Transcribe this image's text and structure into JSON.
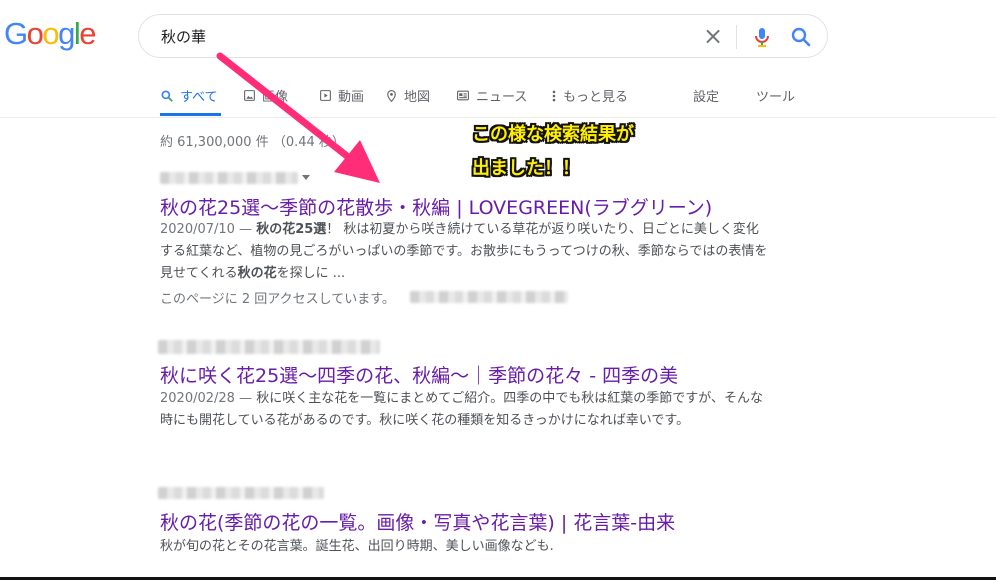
{
  "logo": {
    "letters": [
      "G",
      "o",
      "o",
      "g",
      "l",
      "e"
    ],
    "colors": [
      "#4285F4",
      "#EA4335",
      "#FBBC05",
      "#4285F4",
      "#34A853",
      "#EA4335"
    ]
  },
  "search": {
    "query": "秋の華"
  },
  "tabs": [
    {
      "label": "すべて",
      "icon": "search-icon",
      "active": true
    },
    {
      "label": "画像",
      "icon": "image-icon"
    },
    {
      "label": "動画",
      "icon": "play-icon"
    },
    {
      "label": "地図",
      "icon": "map-pin-icon"
    },
    {
      "label": "ニュース",
      "icon": "news-icon"
    },
    {
      "label": "もっと見る",
      "icon": "more-vert-icon"
    },
    {
      "label": "設定"
    },
    {
      "label": "ツール"
    }
  ],
  "stats": "約 61,300,000 件 （0.44 秒）",
  "results": [
    {
      "title": "秋の花25選〜季節の花散歩・秋編 | LOVEGREEN(ラブグリーン)",
      "date": "2020/07/10 — ",
      "snippet_b1": "秋の花25選",
      "snippet_t1": "！ 秋は初夏から咲き続けている草花が返り咲いたり、日ごとに美しく変化する紅葉など、植物の見ごろがいっぱいの季節です。お散歩にもうってつけの秋、季節ならではの表情を見せてくれる",
      "snippet_b2": "秋の花",
      "snippet_t2": "を探しに ...",
      "visit_note": "このページに 2 回アクセスしています。"
    },
    {
      "title": "秋に咲く花25選〜四季の花、秋編〜｜季節の花々 - 四季の美",
      "date": "2020/02/28 — ",
      "snippet": "秋に咲く主な花を一覧にまとめてご紹介。四季の中でも秋は紅葉の季節ですが、そんな時にも開花している花があるのです。秋に咲く花の種類を知るきっかけになれば幸いです。"
    },
    {
      "title": "秋の花(季節の花の一覧。画像・写真や花言葉) | 花言葉-由来",
      "snippet": "秋が旬の花とその花言葉。誕生花、出回り時期、美しい画像なども."
    }
  ],
  "annotation": {
    "line1": "この様な検索結果が",
    "line2": "出ました！！",
    "arrow_color": "#ff2d78"
  },
  "colors": {
    "link_visited": "#681da8",
    "accent": "#1a73e8",
    "snippet": "#4d5156"
  }
}
